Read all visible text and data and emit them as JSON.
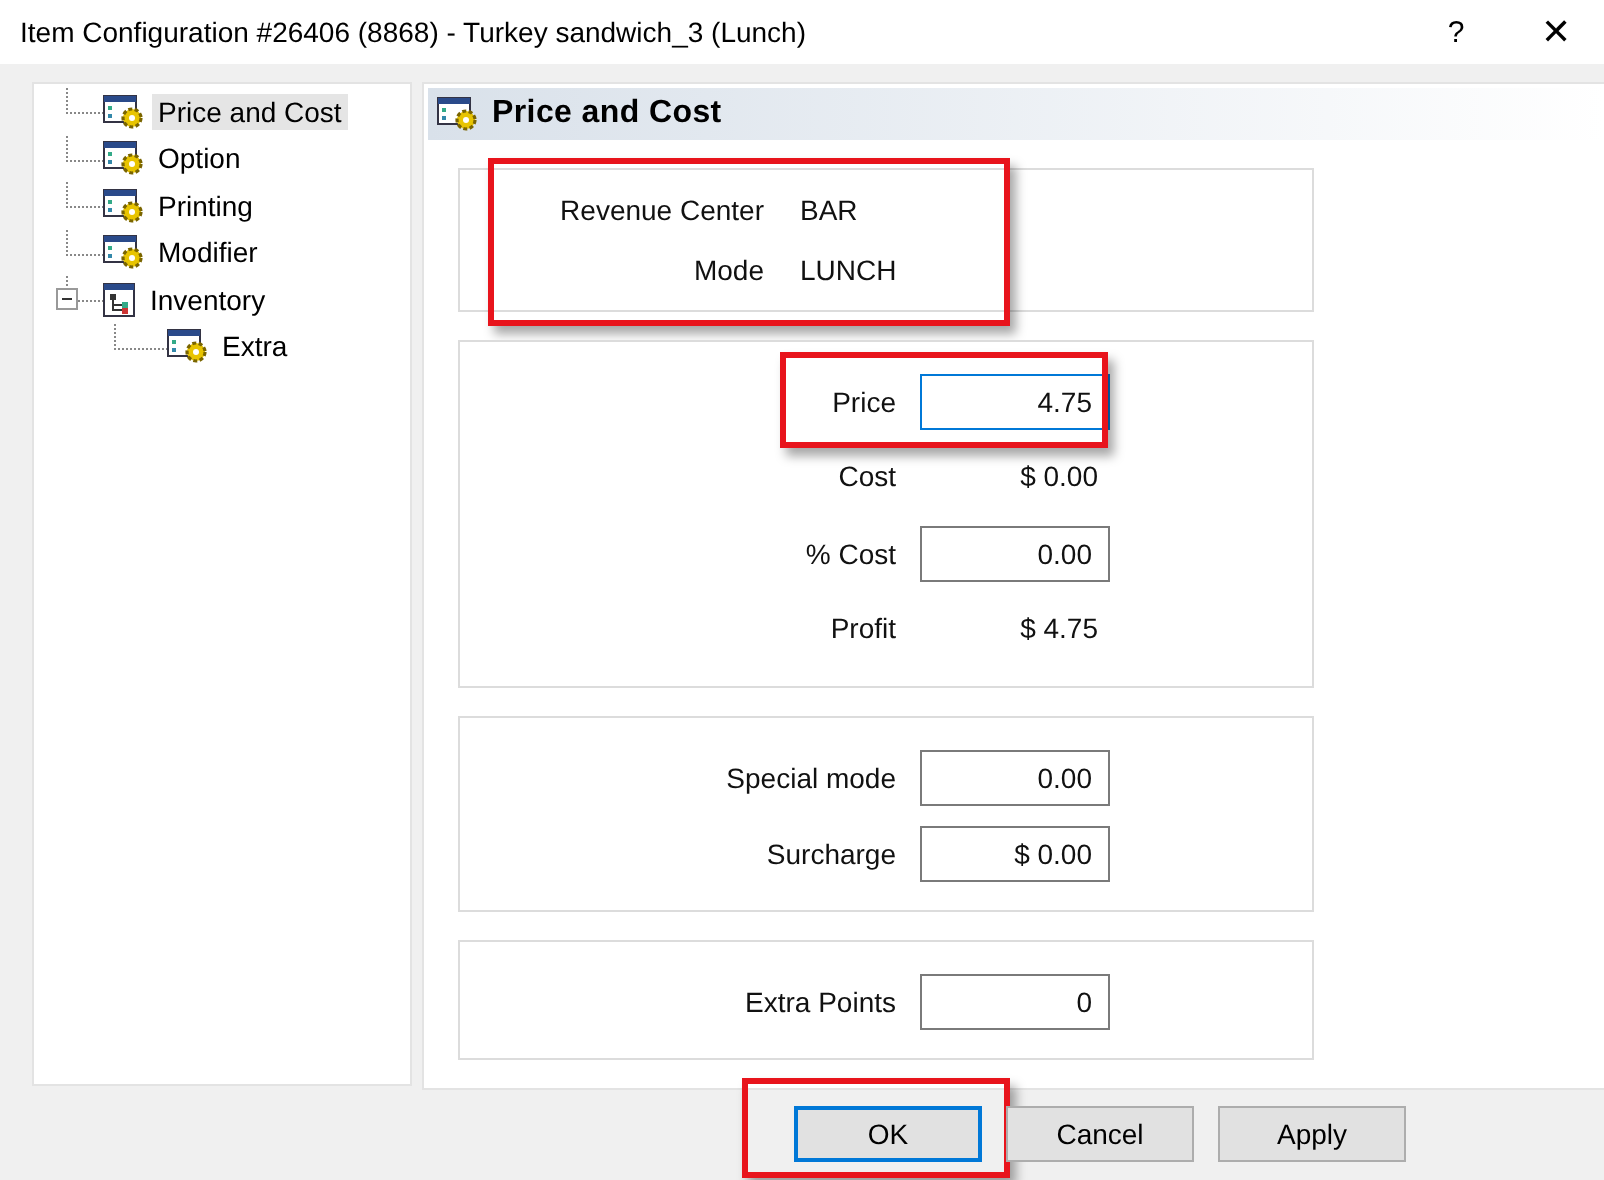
{
  "window": {
    "title": "Item Configuration #26406 (8868) - Turkey sandwich_3 (Lunch)",
    "help": "?",
    "close": "✕"
  },
  "tree": [
    {
      "label": "Price and Cost",
      "selected": true
    },
    {
      "label": "Option",
      "selected": false
    },
    {
      "label": "Printing",
      "selected": false
    },
    {
      "label": "Modifier",
      "selected": false
    },
    {
      "label": "Inventory",
      "selected": false,
      "expanded": true,
      "children": [
        {
          "label": "Extra",
          "selected": false
        }
      ]
    }
  ],
  "panel": {
    "title": "Price and Cost"
  },
  "groups": [
    {
      "highlighted": true,
      "rows": [
        {
          "kind": "info",
          "label": "Revenue Center",
          "value": "BAR",
          "highlighted": false
        },
        {
          "kind": "info",
          "label": "Mode",
          "value": "LUNCH",
          "highlighted": false
        }
      ]
    },
    {
      "highlighted": false,
      "rows": [
        {
          "kind": "input",
          "label": "Price",
          "value": "4.75",
          "highlighted": true,
          "focused": true
        },
        {
          "kind": "value",
          "label": "Cost",
          "value": "$ 0.00",
          "highlighted": false
        },
        {
          "kind": "input",
          "label": "% Cost",
          "value": "0.00",
          "highlighted": false,
          "focused": false
        },
        {
          "kind": "value",
          "label": "Profit",
          "value": "$ 4.75",
          "highlighted": false
        }
      ]
    },
    {
      "highlighted": false,
      "rows": [
        {
          "kind": "input",
          "label": "Special mode",
          "value": "0.00",
          "highlighted": false,
          "focused": false
        },
        {
          "kind": "input",
          "label": "Surcharge",
          "value": "$ 0.00",
          "highlighted": false,
          "focused": false
        }
      ]
    },
    {
      "highlighted": false,
      "rows": [
        {
          "kind": "input",
          "label": "Extra Points",
          "value": "0",
          "highlighted": false,
          "focused": false
        }
      ]
    }
  ],
  "buttons": [
    {
      "label": "OK",
      "default": true,
      "highlighted": true
    },
    {
      "label": "Cancel",
      "default": false,
      "highlighted": false
    },
    {
      "label": "Apply",
      "default": false,
      "highlighted": false
    }
  ]
}
